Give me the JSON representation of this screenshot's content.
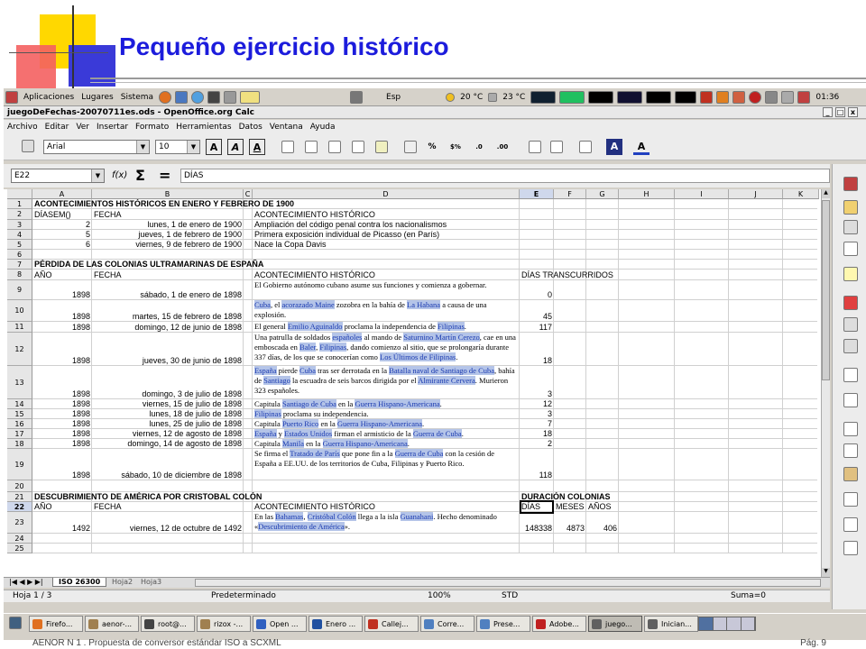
{
  "slide": {
    "title": "Pequeño ejercicio histórico",
    "footer_left": "AENOR N 1 . Propuesta de conversor estándar ISO a SCXML",
    "footer_right": "Pág. 9"
  },
  "gnome": {
    "apps": "Aplicaciones",
    "places": "Lugares",
    "system": "Sistema",
    "lang": "Esp",
    "temp1": "20 °C",
    "temp2": "23 °C",
    "clock": "01:36"
  },
  "window": {
    "title": "juegoDeFechas-20070711es.ods - OpenOffice.org Calc"
  },
  "menu": [
    "Archivo",
    "Editar",
    "Ver",
    "Insertar",
    "Formato",
    "Herramientas",
    "Datos",
    "Ventana",
    "Ayuda"
  ],
  "format": {
    "font": "Arial",
    "size": "10"
  },
  "formula": {
    "cell_ref": "E22",
    "content": "DÍAS",
    "fx": "f(x)",
    "sum": "Σ",
    "eq": "="
  },
  "columns": [
    "A",
    "B",
    "C",
    "D",
    "E",
    "F",
    "G",
    "H",
    "I",
    "J",
    "K"
  ],
  "rows": [
    "1",
    "2",
    "3",
    "4",
    "5",
    "6",
    "7",
    "8",
    "9",
    "10",
    "11",
    "12",
    "13",
    "14",
    "15",
    "16",
    "17",
    "18",
    "19",
    "20",
    "21",
    "22",
    "23",
    "24",
    "25"
  ],
  "cells": {
    "r1": "ACONTECIMIENTOS HISTÓRICOS EN ENERO Y FEBRERO DE 1900",
    "r2a": "DÍASEM()",
    "r2b": "FECHA",
    "r2d": "ACONTECIMIENTO HISTÓRICO",
    "r3a": "2",
    "r3b": "lunes, 1 de enero de 1900",
    "r3d": "Ampliación del código penal contra los nacionalismos",
    "r4a": "5",
    "r4b": "jueves, 1 de febrero de 1900",
    "r4d": "Primera exposición individual de Picasso (en París)",
    "r5a": "6",
    "r5b": "viernes, 9 de febrero de 1900",
    "r5d": "Nace la Copa Davis",
    "r7": "PÉRDIDA DE LAS COLONIAS ULTRAMARINAS DE ESPAÑA",
    "r8a": "AÑO",
    "r8b": "FECHA",
    "r8d": "ACONTECIMIENTO HISTÓRICO",
    "r8e": "DÍAS TRANSCURRIDOS",
    "r9a": "1898",
    "r9b": "sábado, 1 de enero de 1898",
    "r9d": "El Gobierno autónomo cubano asume sus funciones y comienza a gobernar.",
    "r9e": "0",
    "r10a": "1898",
    "r10b": "martes, 15 de febrero de 1898",
    "r10e": "45",
    "r11a": "1898",
    "r11b": "domingo, 12 de junio de 1898",
    "r11e": "117",
    "r12a": "1898",
    "r12b": "jueves, 30 de junio de 1898",
    "r12e": "18",
    "r13a": "1898",
    "r13b": "domingo, 3 de julio de 1898",
    "r13e": "3",
    "r14a": "1898",
    "r14b": "viernes, 15 de julio de 1898",
    "r14e": "12",
    "r15a": "1898",
    "r15b": "lunes, 18 de julio de 1898",
    "r15e": "3",
    "r16a": "1898",
    "r16b": "lunes, 25 de julio de 1898",
    "r16e": "7",
    "r17a": "1898",
    "r17b": "viernes, 12 de agosto de 1898",
    "r17e": "18",
    "r18a": "1898",
    "r18b": "domingo, 14 de agosto de 1898",
    "r18e": "2",
    "r19a": "1898",
    "r19b": "sábado, 10 de diciembre de 1898",
    "r19e": "118",
    "r21": "DESCUBRIMIENTO DE AMÉRICA POR CRISTOBAL COLÓN",
    "r21e": "DURACIÓN COLONIAS",
    "r22a": "AÑO",
    "r22b": "FECHA",
    "r22d": "ACONTECIMIENTO HISTÓRICO",
    "r22e": "DÍAS",
    "r22f": "MESES",
    "r22g": "AÑOS",
    "r23a": "1492",
    "r23b": "viernes, 12 de octubre de 1492",
    "r23e": "148338",
    "r23f": "4873",
    "r23g": "406"
  },
  "tabs": [
    "ISO 26300",
    "Hoja2",
    "Hoja3"
  ],
  "status": {
    "sheet": "Hoja 1 / 3",
    "style": "Predeterminado",
    "zoom": "100%",
    "mode": "STD",
    "sum": "Suma=0"
  },
  "taskbar": [
    "Firefo...",
    "aenor-...",
    "root@...",
    "rizox -...",
    "Open ...",
    "Enero ...",
    "Callej...",
    "Corre...",
    "Prese...",
    "Adobe...",
    "juego...",
    "Inician..."
  ]
}
